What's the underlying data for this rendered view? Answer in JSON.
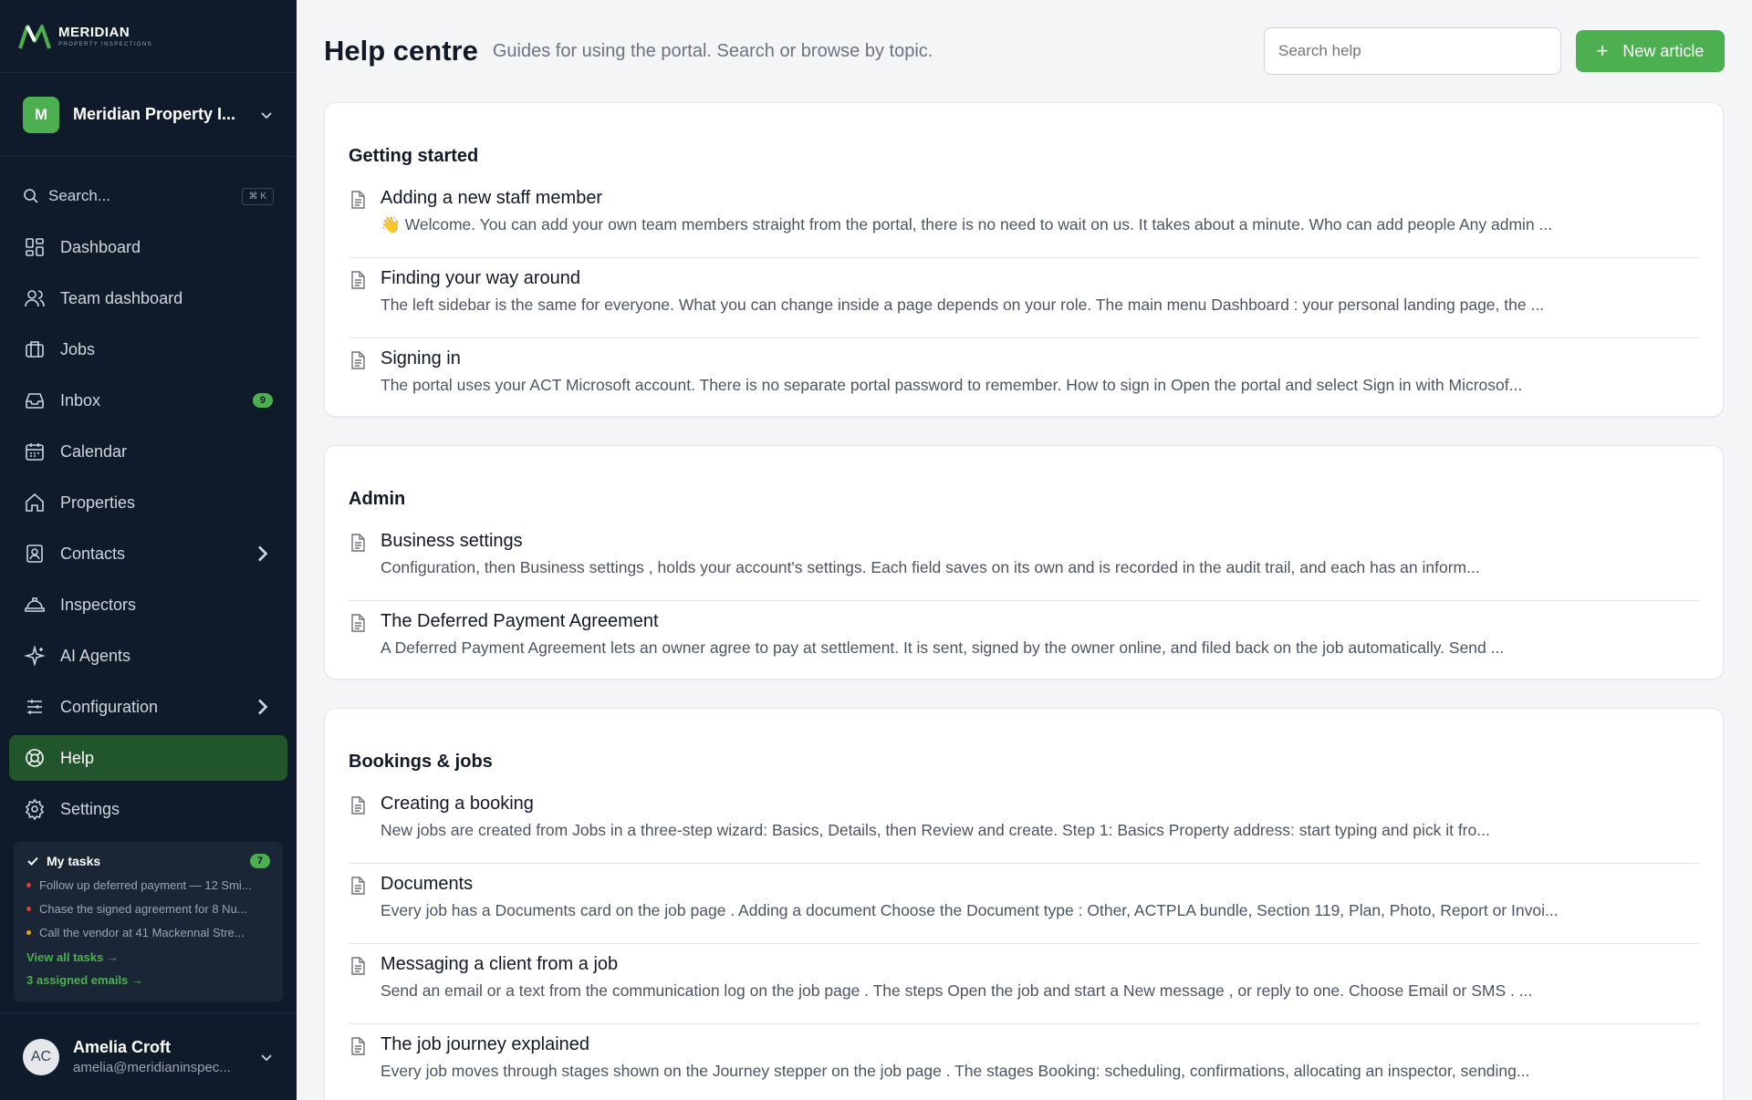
{
  "brand": {
    "name": "MERIDIAN",
    "sub": "PROPERTY INSPECTIONS"
  },
  "org": {
    "initial": "M",
    "name": "Meridian Property I..."
  },
  "search": {
    "label": "Search...",
    "shortcut": "⌘ K"
  },
  "nav": [
    {
      "label": "Dashboard",
      "icon": "dashboard-icon"
    },
    {
      "label": "Team dashboard",
      "icon": "users-icon"
    },
    {
      "label": "Jobs",
      "icon": "briefcase-icon"
    },
    {
      "label": "Inbox",
      "icon": "inbox-icon",
      "badge": "9"
    },
    {
      "label": "Calendar",
      "icon": "calendar-icon"
    },
    {
      "label": "Properties",
      "icon": "home-icon"
    },
    {
      "label": "Contacts",
      "icon": "contact-card-icon",
      "chevron": true
    },
    {
      "label": "Inspectors",
      "icon": "hard-hat-icon"
    },
    {
      "label": "AI Agents",
      "icon": "sparkles-icon"
    },
    {
      "label": "Configuration",
      "icon": "sliders-icon",
      "chevron": true
    },
    {
      "label": "Help",
      "icon": "lifebuoy-icon",
      "active": true
    },
    {
      "label": "Settings",
      "icon": "gear-icon"
    }
  ],
  "tasks": {
    "title": "My tasks",
    "count": "7",
    "items": [
      {
        "text": "Follow up deferred payment — 12 Smi...",
        "color": "#e53935"
      },
      {
        "text": "Chase the signed agreement for 8 Nu...",
        "color": "#e53935"
      },
      {
        "text": "Call the vendor at 41 Mackennal Stre...",
        "color": "#f59e0b"
      }
    ],
    "view_all": "View all tasks →",
    "assigned": "3 assigned emails →"
  },
  "user": {
    "initials": "AC",
    "name": "Amelia Croft",
    "email": "amelia@meridianinspec..."
  },
  "header": {
    "title": "Help centre",
    "subtitle": "Guides for using the portal. Search or browse by topic.",
    "search_placeholder": "Search help",
    "new_label": "New article"
  },
  "sections": [
    {
      "title": "Getting started",
      "articles": [
        {
          "title": "Adding a new staff member",
          "excerpt": "👋 Welcome. You can add your own team members straight from the portal, there is no need to wait on us. It takes about a minute. Who can add people Any admin ..."
        },
        {
          "title": "Finding your way around",
          "excerpt": "The left sidebar is the same for everyone. What you can change inside a page depends on your role. The main menu Dashboard : your personal landing page, the ..."
        },
        {
          "title": "Signing in",
          "excerpt": "The portal uses your ACT Microsoft account. There is no separate portal password to remember. How to sign in Open the portal and select Sign in with Microsof..."
        }
      ]
    },
    {
      "title": "Admin",
      "articles": [
        {
          "title": "Business settings",
          "excerpt": "Configuration, then Business settings , holds your account's settings. Each field saves on its own and is recorded in the audit trail, and each has an inform..."
        },
        {
          "title": "The Deferred Payment Agreement",
          "excerpt": "A Deferred Payment Agreement lets an owner agree to pay at settlement. It is sent, signed by the owner online, and filed back on the job automatically. Send ..."
        }
      ]
    },
    {
      "title": "Bookings & jobs",
      "articles": [
        {
          "title": "Creating a booking",
          "excerpt": "New jobs are created from Jobs in a three-step wizard: Basics, Details, then Review and create. Step 1: Basics Property address: start typing and pick it fro..."
        },
        {
          "title": "Documents",
          "excerpt": "Every job has a Documents card on the job page . Adding a document Choose the Document type : Other, ACTPLA bundle, Section 119, Plan, Photo, Report or Invoi..."
        },
        {
          "title": "Messaging a client from a job",
          "excerpt": "Send an email or a text from the communication log on the job page . The steps Open the job and start a New message , or reply to one. Choose Email or SMS . ..."
        },
        {
          "title": "The job journey explained",
          "excerpt": "Every job moves through stages shown on the Journey stepper on the job page . The stages Booking: scheduling, confirmations, allocating an inspector, sending..."
        }
      ]
    }
  ]
}
